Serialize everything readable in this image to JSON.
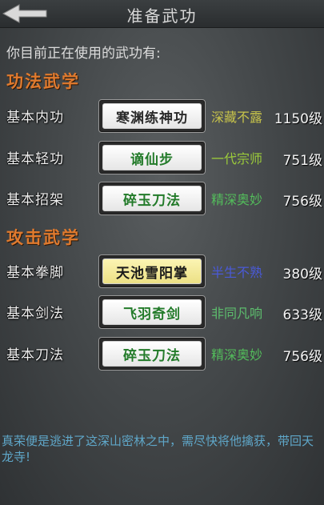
{
  "header": {
    "title": "准备武功",
    "back_icon": "back-arrow-icon"
  },
  "subtitle": "你目前正在使用的武功有:",
  "sections": [
    {
      "title": "功法武学",
      "rows": [
        {
          "label": "基本内功",
          "skill": "寒渊练神功",
          "rank": "深藏不露",
          "rank_color": "#c7c34a",
          "level": "1150级"
        },
        {
          "label": "基本轻功",
          "skill": "谪仙步",
          "rank": "一代宗师",
          "rank_color": "#9ccc3a",
          "level": "751级"
        },
        {
          "label": "基本招架",
          "skill": "碎玉刀法",
          "rank": "精深奥妙",
          "rank_color": "#53bd5b",
          "level": "756级"
        }
      ]
    },
    {
      "title": "攻击武学",
      "rows": [
        {
          "label": "基本拳脚",
          "skill": "天池雪阳掌",
          "rank": "半生不熟",
          "rank_color": "#4a5ad8",
          "level": "380级"
        },
        {
          "label": "基本剑法",
          "skill": "飞羽奇剑",
          "rank": "非同凡响",
          "rank_color": "#5dbd6d",
          "level": "633级"
        },
        {
          "label": "基本刀法",
          "skill": "碎玉刀法",
          "rank": "精深奥妙",
          "rank_color": "#53bd5b",
          "level": "756级"
        }
      ]
    }
  ],
  "message": "真荣便是逃进了这深山密林之中，需尽快将他擒获，带回天龙寺!"
}
